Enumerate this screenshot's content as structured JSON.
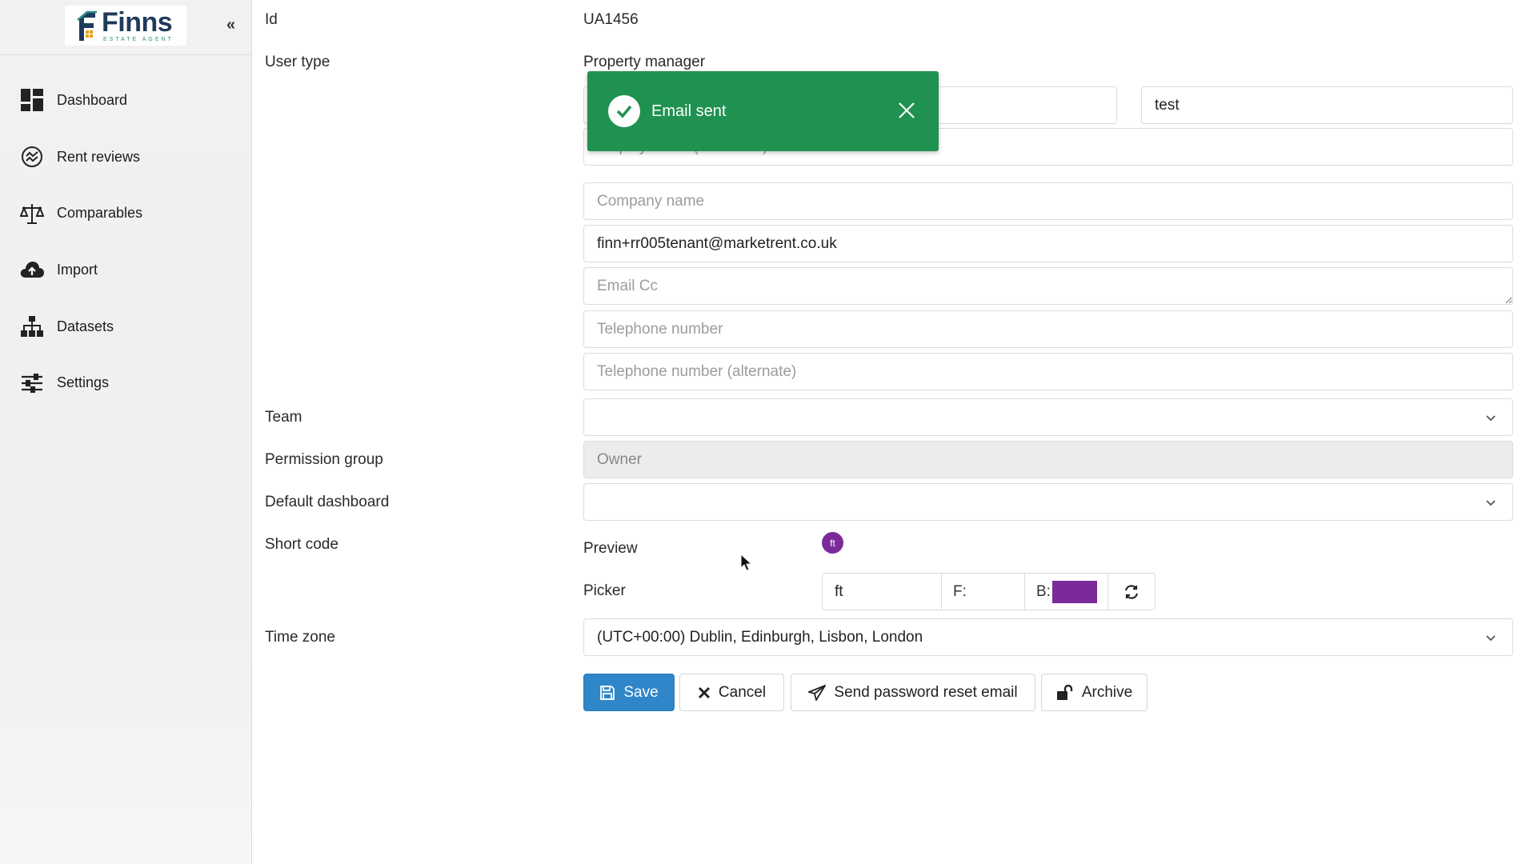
{
  "sidebar": {
    "logo": {
      "name": "Finns",
      "subtitle": "ESTATE AGENT"
    },
    "collapse_label": "«",
    "items": [
      {
        "label": "Dashboard",
        "icon": "dashboard-icon"
      },
      {
        "label": "Rent reviews",
        "icon": "rent-reviews-icon"
      },
      {
        "label": "Comparables",
        "icon": "scales-icon"
      },
      {
        "label": "Import",
        "icon": "cloud-upload-icon"
      },
      {
        "label": "Datasets",
        "icon": "hierarchy-icon"
      },
      {
        "label": "Settings",
        "icon": "sliders-icon"
      }
    ]
  },
  "form": {
    "id_label": "Id",
    "id_value": "UA1456",
    "user_type_label": "User type",
    "user_type_value": "Property manager",
    "last_name_value": "test",
    "display_name_placeholder": "Display name (known as)",
    "company_name_placeholder": "Company name",
    "email_value": "finn+rr005tenant@marketrent.co.uk",
    "email_cc_placeholder": "Email Cc",
    "telephone_placeholder": "Telephone number",
    "telephone_alt_placeholder": "Telephone number (alternate)",
    "team_label": "Team",
    "team_value": "",
    "permission_group_label": "Permission group",
    "permission_group_value": "Owner",
    "default_dashboard_label": "Default dashboard",
    "default_dashboard_value": "",
    "short_code_label": "Short code",
    "preview_label": "Preview",
    "preview_badge": "ft",
    "picker_label": "Picker",
    "picker_text_value": "ft",
    "picker_fg_label": "F:",
    "picker_bg_label": "B:",
    "picker_bg_color": "#7b2a9a",
    "time_zone_label": "Time zone",
    "time_zone_value": "(UTC+00:00) Dublin, Edinburgh, Lisbon, London"
  },
  "toast": {
    "message": "Email sent",
    "color": "#1f9251"
  },
  "actions": {
    "save_label": "Save",
    "cancel_label": "Cancel",
    "reset_label": "Send password reset email",
    "archive_label": "Archive"
  },
  "colors": {
    "primary": "#2f86c9",
    "accent_purple": "#7b2a9a"
  }
}
